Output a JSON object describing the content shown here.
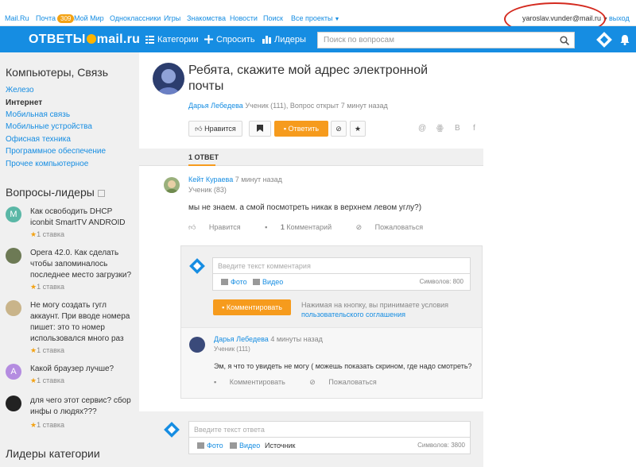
{
  "topbar": {
    "links": [
      "Mail.Ru",
      "Почта",
      "Мой Мир",
      "Одноклассники",
      "Игры",
      "Знакомства",
      "Новости",
      "Поиск",
      "Все проекты"
    ],
    "mail_count": "309",
    "user_email": "yaroslav.vunder@mail.ru",
    "logout": "выход"
  },
  "navbar": {
    "logo_left": "ОТВЕТЫ",
    "logo_right": "mail.ru",
    "categories": "Категории",
    "ask": "Спросить",
    "leaders": "Лидеры",
    "search_placeholder": "Поиск по вопросам"
  },
  "sidebar": {
    "section_title": "Компьютеры, Связь",
    "categories": [
      "Железо",
      "Интернет",
      "Мобильная связь",
      "Мобильные устройства",
      "Офисная техника",
      "Программное обеспечение",
      "Прочее компьютерное"
    ],
    "leaders_title": "Вопросы-лидеры",
    "leader_questions": [
      {
        "text": "Как освободить DHCP iconbit SmartTV ANDROID",
        "stake": "1 ставка",
        "avatar_letter": "M",
        "avatar_color": "#5ab7a6"
      },
      {
        "text": "Opera 42.0. Как сделать чтобы запоминалось последнее место загрузки?",
        "stake": "1 ставка",
        "avatar_letter": "",
        "avatar_color": "#6d7a55"
      },
      {
        "text": "Не могу создать гугл аккаунт. При вводе номера пишет: это то номер использовался много раз",
        "stake": "1 ставка",
        "avatar_letter": "",
        "avatar_color": "#c9b48a"
      },
      {
        "text": "Какой браузер лучше?",
        "stake": "1 ставка",
        "avatar_letter": "A",
        "avatar_color": "#b48ce0"
      },
      {
        "text": "для чего этот сервис? сбор инфы о людях???",
        "stake": "1 ставка",
        "avatar_letter": "",
        "avatar_color": "#222222"
      }
    ],
    "category_leaders_title": "Лидеры категории"
  },
  "question": {
    "title": "Ребята, скажите мой адрес электронной почты",
    "author": "Дарья Лебедева",
    "meta": "Ученик (111), Вопрос открыт 7 минут назад",
    "like": "Нравится",
    "answer": "Ответить",
    "share_icons": [
      "@",
      "ok",
      "B",
      "f"
    ]
  },
  "answers": {
    "count_label": "1 ОТВЕТ",
    "items": [
      {
        "author": "Кейт Кураева",
        "time": "7 минут назад",
        "role": "Ученик (83)",
        "text": "мы не знаем. а смой посмотреть никак в верхнем левом углу?)",
        "like": "Нравится",
        "comments_count": "1",
        "comments_label": "Комментарий",
        "complain": "Пожаловаться"
      }
    ]
  },
  "comment_form": {
    "placeholder": "Введите текст комментария",
    "photo": "Фото",
    "video": "Видео",
    "chars": "Символов: 800",
    "submit": "Комментировать",
    "note_1": "Нажимая на кнопку, вы принимаете условия",
    "note_link": "пользовательского соглашения"
  },
  "reply": {
    "author": "Дарья Лебедева",
    "time": "4 минуты назад",
    "role": "Ученик (111)",
    "text": "Эм, я что то увидеть не могу ( можешь показать скрином, где надо смотреть?",
    "comment": "Комментировать",
    "complain": "Пожаловаться"
  },
  "answer_form": {
    "placeholder": "Введите текст ответа",
    "photo": "Фото",
    "video": "Видео",
    "source": "Источник",
    "chars": "Символов: 3800"
  }
}
